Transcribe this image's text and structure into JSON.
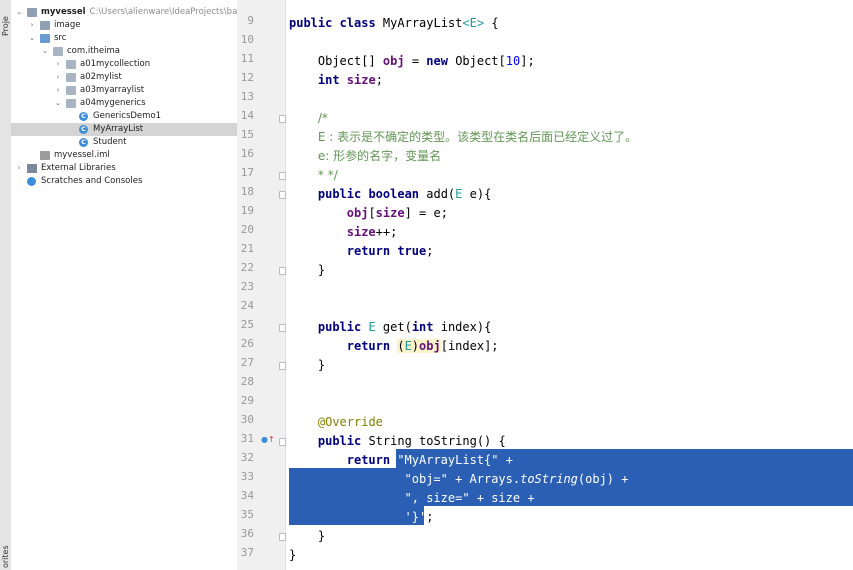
{
  "side_strip": {
    "top_label": "Proje",
    "bottom_label": "orites"
  },
  "project_tree": [
    {
      "label": "myvessel",
      "path": "C:\\Users\\alienware\\IdeaProjects\\basic-cod",
      "bold": true,
      "icon": "folder-icon",
      "level": 0,
      "expanded": true
    },
    {
      "label": "image",
      "icon": "folder-icon",
      "level": 1,
      "expanded": false
    },
    {
      "label": "src",
      "icon": "source-folder-icon",
      "level": 1,
      "expanded": true
    },
    {
      "label": "com.itheima",
      "icon": "package-icon",
      "level": 2,
      "expanded": true
    },
    {
      "label": "a01mycollection",
      "icon": "package-icon",
      "level": 3,
      "expanded": false
    },
    {
      "label": "a02mylist",
      "icon": "package-icon",
      "level": 3,
      "expanded": false
    },
    {
      "label": "a03myarraylist",
      "icon": "package-icon",
      "level": 3,
      "expanded": false
    },
    {
      "label": "a04mygenerics",
      "icon": "package-icon",
      "level": 3,
      "expanded": true
    },
    {
      "label": "GenericsDemo1",
      "icon": "class-icon",
      "level": 4
    },
    {
      "label": "MyArrayList",
      "icon": "class-icon",
      "level": 4,
      "selected": true
    },
    {
      "label": "Student",
      "icon": "class-icon",
      "level": 4
    },
    {
      "label": "myvessel.iml",
      "icon": "iml-file-icon",
      "level": 1
    },
    {
      "label": "External Libraries",
      "icon": "library-icon",
      "level": 0,
      "expanded": false
    },
    {
      "label": "Scratches and Consoles",
      "icon": "scratches-icon",
      "level": 0
    }
  ],
  "line_numbers": [
    "9",
    "10",
    "11",
    "12",
    "13",
    "14",
    "15",
    "16",
    "17",
    "18",
    "19",
    "20",
    "21",
    "22",
    "23",
    "24",
    "25",
    "26",
    "27",
    "28",
    "29",
    "30",
    "31",
    "32",
    "33",
    "34",
    "35",
    "36",
    "37"
  ],
  "code": {
    "l9": [
      "public class ",
      "MyArrayList",
      "<E>",
      " {"
    ],
    "l11": [
      "Object[] ",
      "obj",
      " = ",
      "new ",
      "Object[",
      "10",
      "];"
    ],
    "l12": [
      "int ",
      "size",
      ";"
    ],
    "l14": "/*",
    "l15": "E : 表示是不确定的类型。该类型在类名后面已经定义过了。",
    "l16": "e: 形参的名字，变量名",
    "l17": "* */",
    "l18": [
      "public boolean ",
      "add(",
      "E",
      " e){"
    ],
    "l19": [
      "obj",
      "[",
      "size",
      "] = e;"
    ],
    "l20": [
      "size",
      "++;"
    ],
    "l21": [
      "return true",
      ";"
    ],
    "l22": "}",
    "l25": [
      "public ",
      "E",
      " get(",
      "int ",
      "index){"
    ],
    "l26": [
      "return ",
      "(",
      "E",
      ")",
      "obj",
      "[index];"
    ],
    "l27": "}",
    "l30": "@Override",
    "l31": [
      "public ",
      "String toString() {"
    ],
    "l32": [
      "return ",
      "\"MyArrayList{\" +"
    ],
    "l33": [
      "\"obj=\" + Arrays.",
      "toString",
      "(obj) +"
    ],
    "l34": [
      "\", size=\" + size +"
    ],
    "l35": [
      "'}'",
      ";"
    ],
    "l36": "}",
    "l37": "}"
  },
  "colors": {
    "selection": "#2a5fb3",
    "keyword": "#000080",
    "string": "#008000",
    "comment_cn": "#629755",
    "annotation": "#808000"
  }
}
